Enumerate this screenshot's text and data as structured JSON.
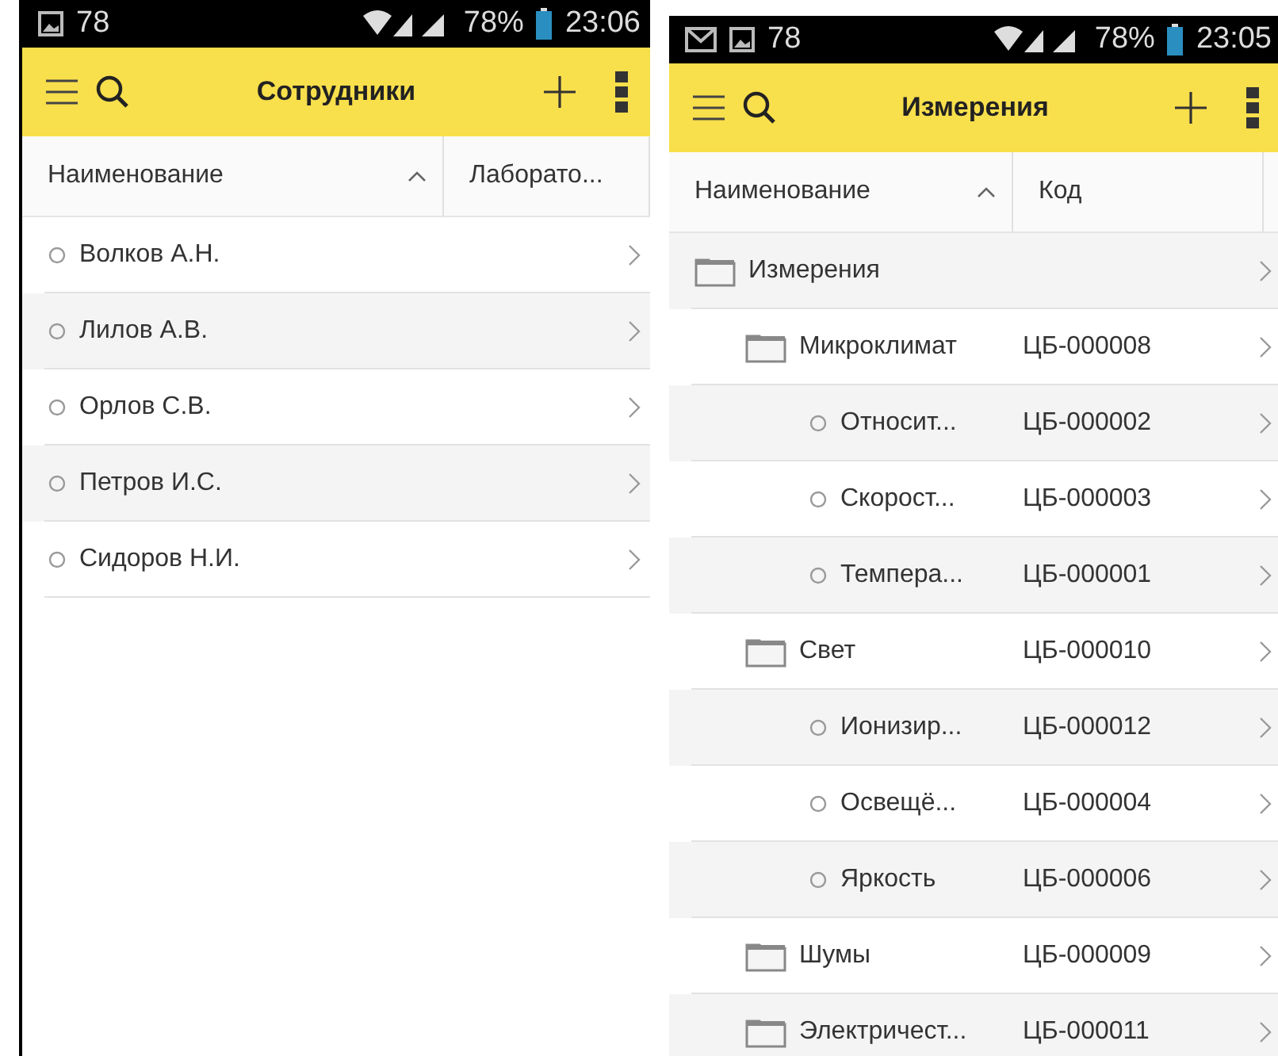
{
  "screens": [
    {
      "status_bar": {
        "notifications": "78",
        "battery": "78%",
        "time": "23:06",
        "mail": false
      },
      "toolbar": {
        "title": "Сотрудники"
      },
      "columns": [
        {
          "label": "Наименование",
          "sorted": true
        },
        {
          "label": "Лаборато...",
          "sorted": false
        }
      ],
      "rows": [
        {
          "kind": "item",
          "name": "Волков А.Н.",
          "cells": []
        },
        {
          "kind": "item",
          "name": "Лилов А.В.",
          "cells": []
        },
        {
          "kind": "item",
          "name": "Орлов С.В.",
          "cells": []
        },
        {
          "kind": "item",
          "name": "Петров И.С.",
          "cells": []
        },
        {
          "kind": "item",
          "name": "Сидоров Н.И.",
          "cells": []
        }
      ]
    },
    {
      "status_bar": {
        "notifications": "78",
        "battery": "78%",
        "time": "23:05",
        "mail": true
      },
      "toolbar": {
        "title": "Измерения"
      },
      "columns": [
        {
          "label": "Наименование",
          "sorted": true
        },
        {
          "label": "Код",
          "sorted": false
        }
      ],
      "rows": [
        {
          "kind": "folder",
          "name": "Измерения",
          "cells": [],
          "children": [
            {
              "kind": "folder",
              "name": "Микроклимат",
              "cells": [
                "ЦБ-000008"
              ],
              "children": [
                {
                  "kind": "item",
                  "name": "Относит...",
                  "cells": [
                    "ЦБ-000002"
                  ]
                },
                {
                  "kind": "item",
                  "name": "Скорост...",
                  "cells": [
                    "ЦБ-000003"
                  ]
                },
                {
                  "kind": "item",
                  "name": "Темпера...",
                  "cells": [
                    "ЦБ-000001"
                  ]
                }
              ]
            },
            {
              "kind": "folder",
              "name": "Свет",
              "cells": [
                "ЦБ-000010"
              ],
              "children": [
                {
                  "kind": "item",
                  "name": "Ионизир...",
                  "cells": [
                    "ЦБ-000012"
                  ]
                },
                {
                  "kind": "item",
                  "name": "Освещё...",
                  "cells": [
                    "ЦБ-000004"
                  ]
                },
                {
                  "kind": "item",
                  "name": "Яркость",
                  "cells": [
                    "ЦБ-000006"
                  ]
                }
              ]
            },
            {
              "kind": "folder",
              "name": "Шумы",
              "cells": [
                "ЦБ-000009"
              ]
            },
            {
              "kind": "folder",
              "name": "Электричест...",
              "cells": [
                "ЦБ-000011"
              ]
            }
          ]
        }
      ]
    }
  ]
}
